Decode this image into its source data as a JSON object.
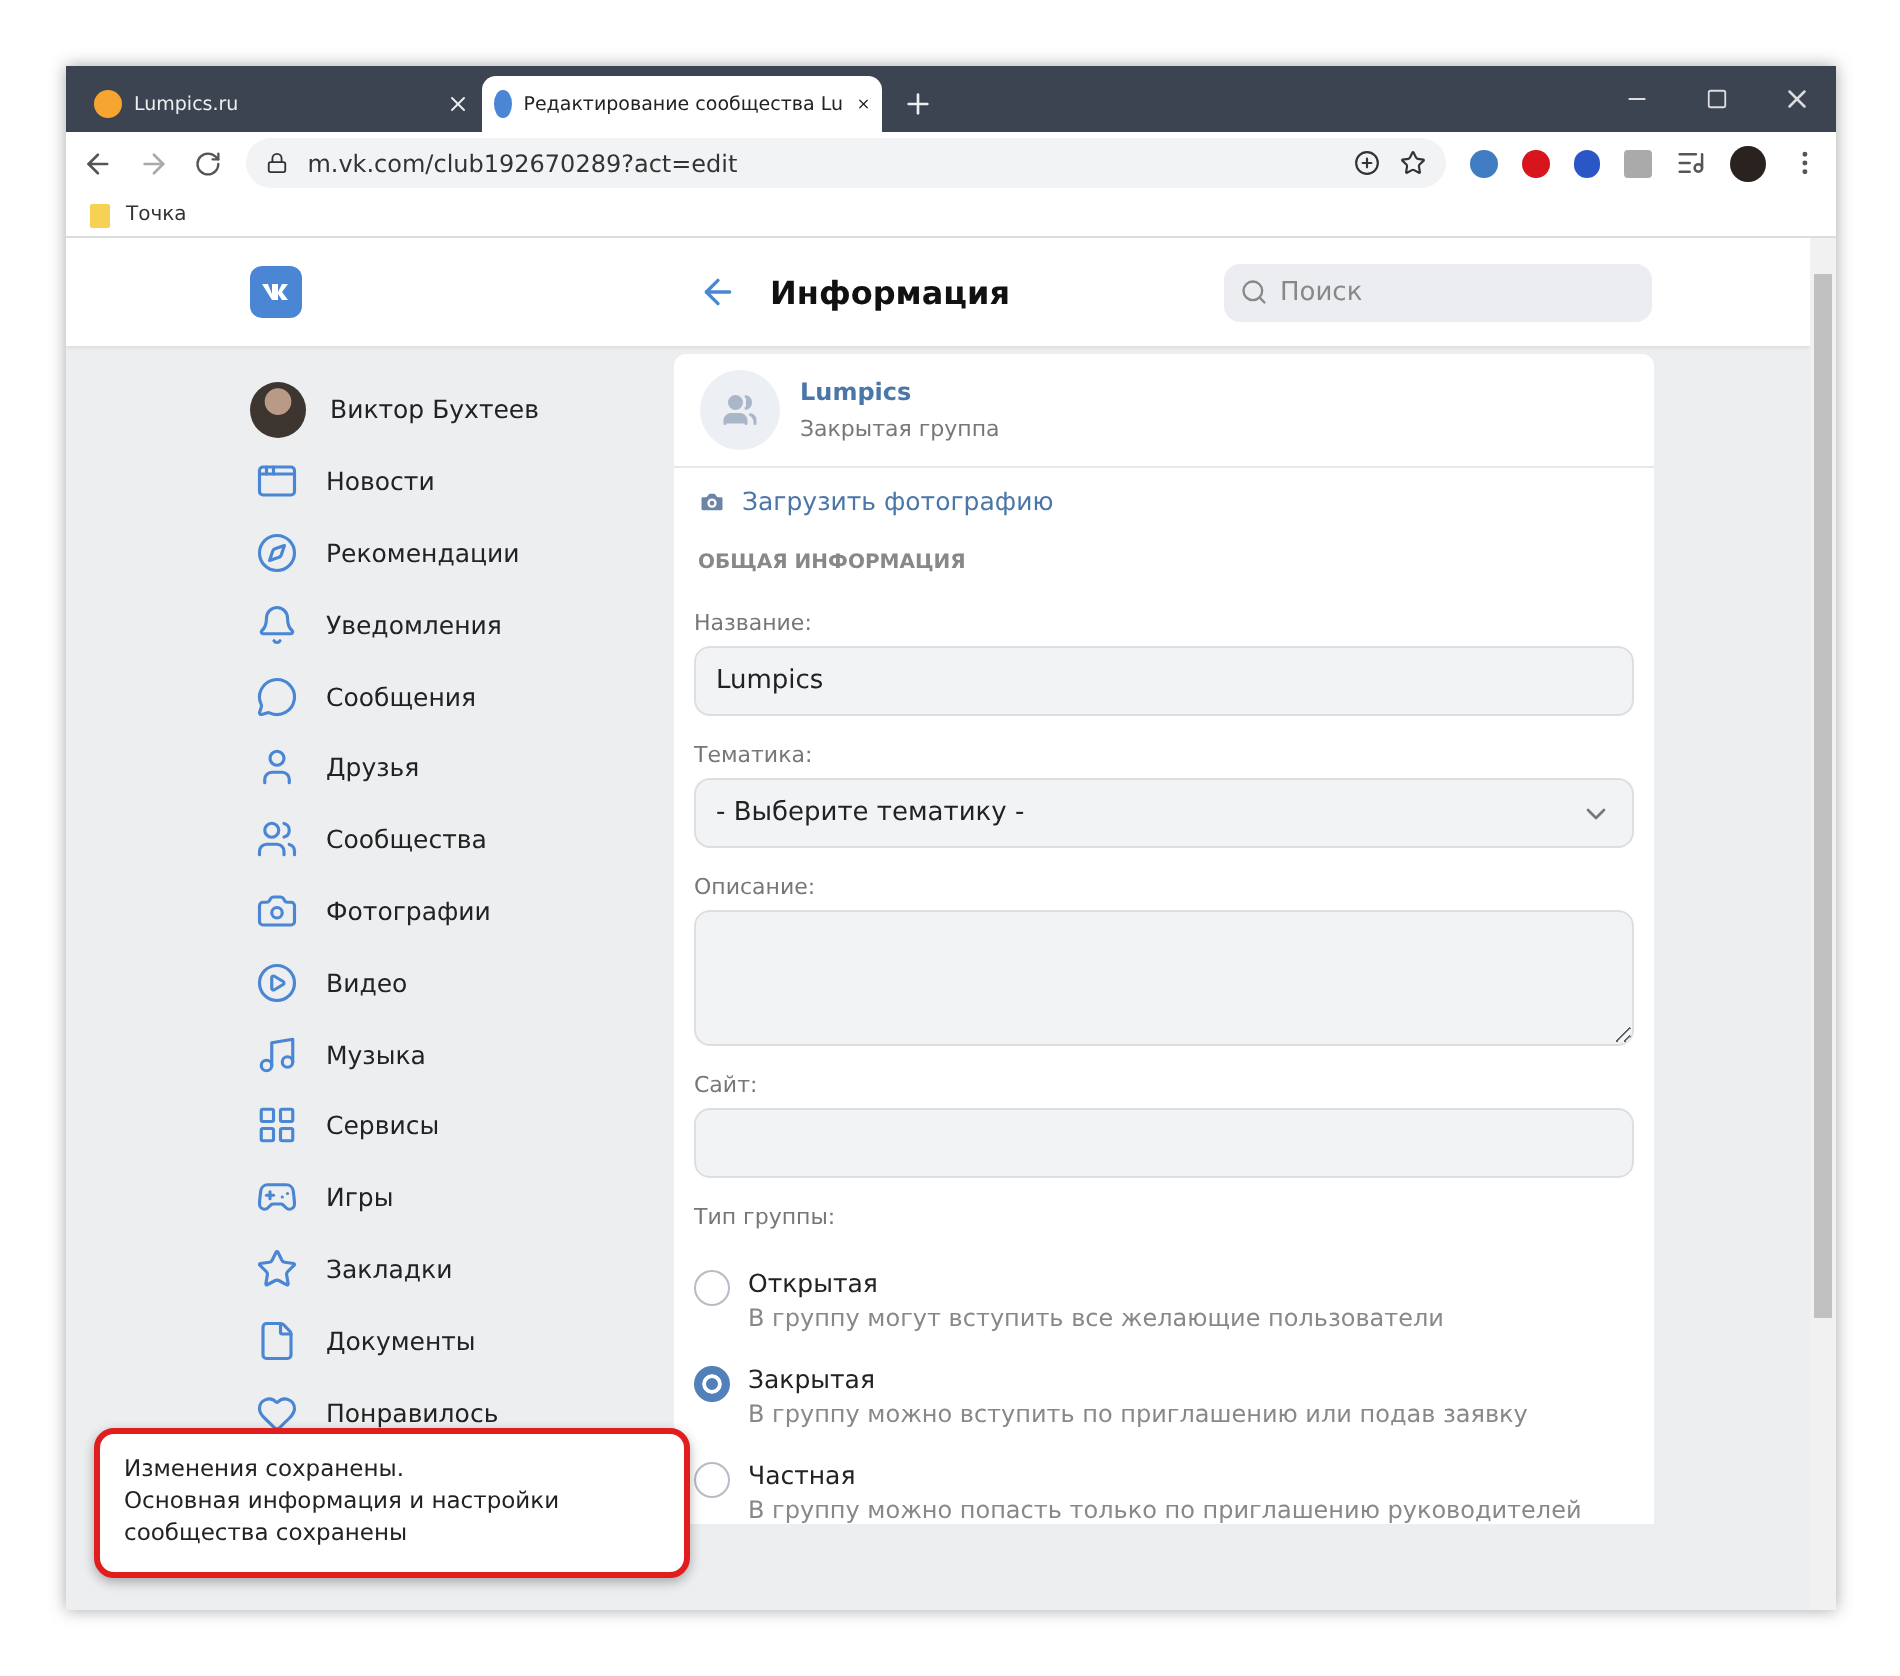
{
  "browser": {
    "tabs": [
      {
        "title": "Lumpics.ru",
        "selected": false
      },
      {
        "title": "Редактирование сообщества Lu",
        "selected": true
      }
    ],
    "address": "m.vk.com/club192670289?act=edit",
    "bookmarks": [
      "Точка"
    ]
  },
  "header": {
    "title": "Информация",
    "search": {
      "placeholder": "Поиск"
    }
  },
  "sidebar": {
    "user": "Виктор Бухтеев",
    "items": [
      {
        "label": "Новости"
      },
      {
        "label": "Рекомендации"
      },
      {
        "label": "Уведомления"
      },
      {
        "label": "Сообщения"
      },
      {
        "label": "Друзья"
      },
      {
        "label": "Сообщества"
      },
      {
        "label": "Фотографии"
      },
      {
        "label": "Видео"
      },
      {
        "label": "Музыка"
      },
      {
        "label": "Сервисы"
      },
      {
        "label": "Игры"
      },
      {
        "label": "Закладки"
      },
      {
        "label": "Документы"
      },
      {
        "label": "Понравилось"
      }
    ]
  },
  "group": {
    "name": "Lumpics",
    "type": "Закрытая группа",
    "upload_link": "Загрузить фотографию"
  },
  "form": {
    "section": "ОБЩАЯ ИНФОРМАЦИЯ",
    "fields": [
      {
        "kind": "input",
        "label": "Название:",
        "value": "Lumpics"
      },
      {
        "kind": "select",
        "label": "Тематика:",
        "value": "- Выберите тематику -"
      },
      {
        "kind": "textarea",
        "label": "Описание:"
      },
      {
        "kind": "input",
        "label": "Сайт:"
      }
    ],
    "group_type_label": "Тип группы:",
    "group_types": [
      {
        "title": "Открытая",
        "description": "В группу могут вступить все желающие пользователи",
        "selected": false
      },
      {
        "title": "Закрытая",
        "description": "В группу можно вступить по приглашению или подав заявку",
        "selected": true
      },
      {
        "title": "Частная",
        "description": "В группу можно попасть только по приглашению руководителей",
        "selected": false
      }
    ]
  },
  "toast": {
    "title": "Изменения сохранены.",
    "message": "Основная информация и настройки сообщества сохранены",
    "highlighted": true
  }
}
